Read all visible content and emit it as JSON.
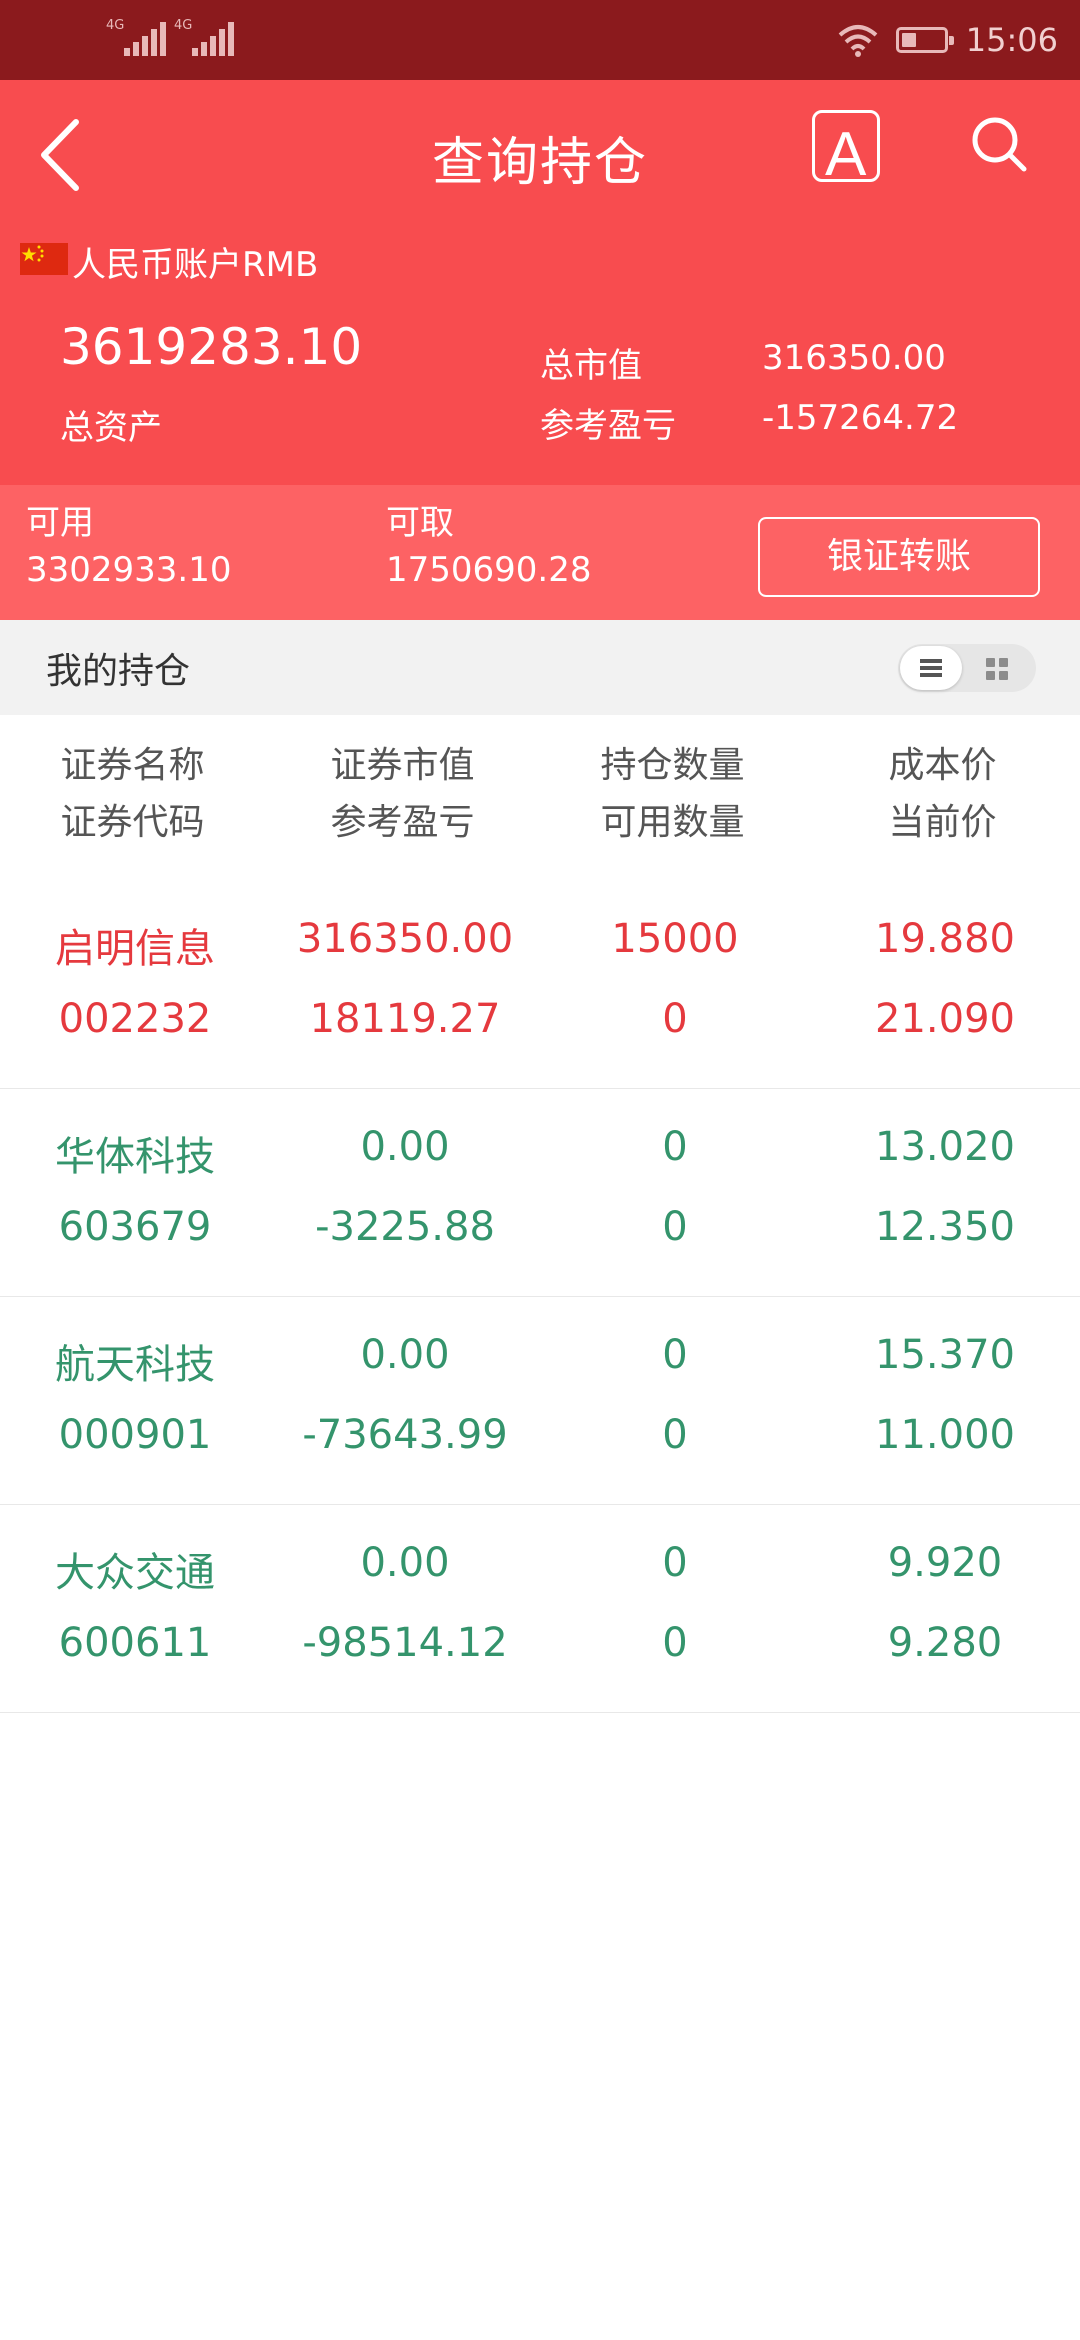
{
  "status_bar": {
    "signal_1": "4G",
    "signal_2": "4G",
    "time": "15:06",
    "battery_level": 0.35
  },
  "header": {
    "title": "查询持仓",
    "font_button": "A",
    "account_label": "人民币账户RMB",
    "total_assets_value": "3619283.10",
    "total_assets_label": "总资产",
    "market_value_label": "总市值",
    "market_value": "316350.00",
    "ref_pnl_label": "参考盈亏",
    "ref_pnl_value": "-157264.72"
  },
  "balance": {
    "available_label": "可用",
    "available_value": "3302933.10",
    "withdrawable_label": "可取",
    "withdrawable_value": "1750690.28",
    "transfer_button": "银证转账"
  },
  "holdings": {
    "title": "我的持仓",
    "columns": [
      {
        "line1": "证券名称",
        "line2": "证券代码"
      },
      {
        "line1": "证券市值",
        "line2": "参考盈亏"
      },
      {
        "line1": "持仓数量",
        "line2": "可用数量"
      },
      {
        "line1": "成本价",
        "line2": "当前价"
      }
    ],
    "rows": [
      {
        "name": "启明信息",
        "code": "002232",
        "market_value": "316350.00",
        "pnl": "18119.27",
        "qty": "15000",
        "avail_qty": "0",
        "cost": "19.880",
        "price": "21.090",
        "color": "#e5393e"
      },
      {
        "name": "华体科技",
        "code": "603679",
        "market_value": "0.00",
        "pnl": "-3225.88",
        "qty": "0",
        "avail_qty": "0",
        "cost": "13.020",
        "price": "12.350",
        "color": "#34946c"
      },
      {
        "name": "航天科技",
        "code": "000901",
        "market_value": "0.00",
        "pnl": "-73643.99",
        "qty": "0",
        "avail_qty": "0",
        "cost": "15.370",
        "price": "11.000",
        "color": "#34946c"
      },
      {
        "name": "大众交通",
        "code": "600611",
        "market_value": "0.00",
        "pnl": "-98514.12",
        "qty": "0",
        "avail_qty": "0",
        "cost": "9.920",
        "price": "9.280",
        "color": "#34946c"
      }
    ]
  },
  "icons": {
    "back": "back-arrow-icon",
    "font": "font-size-icon",
    "search": "search-icon",
    "flag": "china-flag-icon",
    "wifi": "wifi-icon",
    "battery": "battery-icon"
  }
}
